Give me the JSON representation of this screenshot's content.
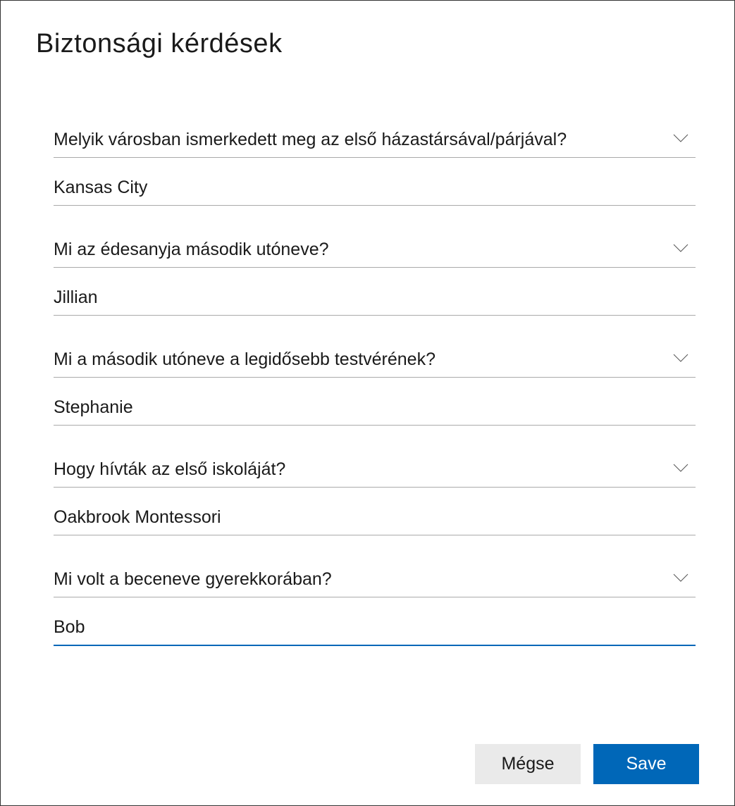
{
  "title": "Biztonsági kérdések",
  "questions": {
    "0": {
      "question": "Melyik városban ismerkedett meg az első házastársával/párjával?",
      "answer": "Kansas City"
    },
    "1": {
      "question": "Mi az édesanyja második utóneve?",
      "answer": "Jillian"
    },
    "2": {
      "question": "Mi a második utóneve a legidősebb testvérének?",
      "answer": "Stephanie"
    },
    "3": {
      "question": "Hogy hívták az első iskoláját?",
      "answer": "Oakbrook Montessori"
    },
    "4": {
      "question": "Mi volt a beceneve gyerekkorában?",
      "answer": "Bob"
    }
  },
  "buttons": {
    "cancel": "Mégse",
    "save": "Save"
  }
}
